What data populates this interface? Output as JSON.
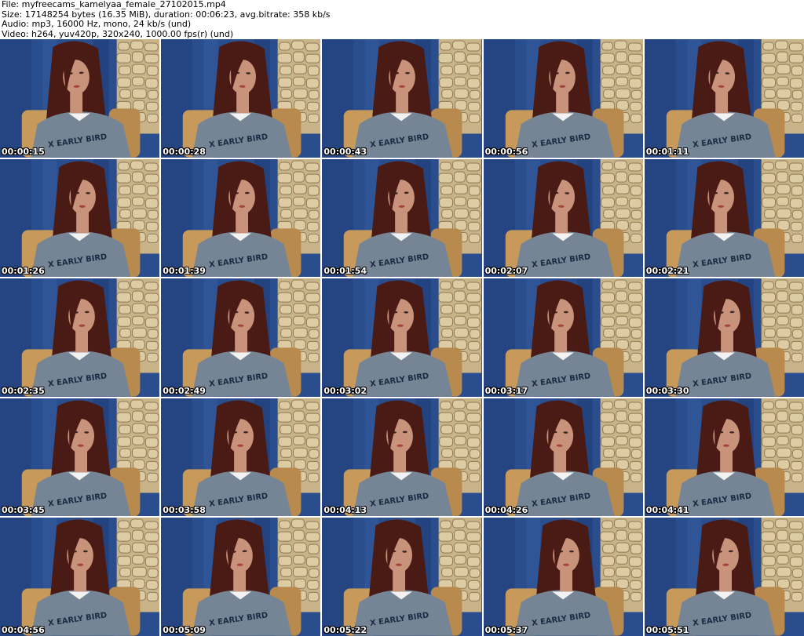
{
  "header": {
    "file_line": "File: myfreecams_kamelyaa_female_27102015.mp4",
    "size_line": "Size: 17148254 bytes (16.35 MiB), duration: 00:06:23, avg.bitrate: 358 kb/s",
    "audio_line": "Audio: mp3, 16000 Hz, mono, 24 kb/s (und)",
    "video_line": "Video: h264, yuv420p, 320x240, 1000.00 fps(r) (und)"
  },
  "thumbnails": [
    {
      "timestamp": "00:00:15",
      "shirt_text": "X EARLY BIRD"
    },
    {
      "timestamp": "00:00:28",
      "shirt_text": "X EARLY BIRD"
    },
    {
      "timestamp": "00:00:43",
      "shirt_text": "X EARLY BIRD"
    },
    {
      "timestamp": "00:00:56",
      "shirt_text": "X EARLY BIRD"
    },
    {
      "timestamp": "00:01:11",
      "shirt_text": "X EARLY BIRD"
    },
    {
      "timestamp": "00:01:26",
      "shirt_text": "X EARLY BIRD"
    },
    {
      "timestamp": "00:01:39",
      "shirt_text": "X EARLY BIRD"
    },
    {
      "timestamp": "00:01:54",
      "shirt_text": "X EARLY BIRD"
    },
    {
      "timestamp": "00:02:07",
      "shirt_text": "X EARLY BIRD"
    },
    {
      "timestamp": "00:02:21",
      "shirt_text": "X EARLY BIRD"
    },
    {
      "timestamp": "00:02:35",
      "shirt_text": "X EARLY BIRD"
    },
    {
      "timestamp": "00:02:49",
      "shirt_text": "X EARLY BIRD"
    },
    {
      "timestamp": "00:03:02",
      "shirt_text": "X EARLY BIRD"
    },
    {
      "timestamp": "00:03:17",
      "shirt_text": "X EARLY BIRD"
    },
    {
      "timestamp": "00:03:30",
      "shirt_text": "X EARLY BIRD"
    },
    {
      "timestamp": "00:03:45",
      "shirt_text": "X EARLY BIRD"
    },
    {
      "timestamp": "00:03:58",
      "shirt_text": "X EARLY BIRD"
    },
    {
      "timestamp": "00:04:13",
      "shirt_text": "X EARLY BIRD"
    },
    {
      "timestamp": "00:04:26",
      "shirt_text": "X EARLY BIRD"
    },
    {
      "timestamp": "00:04:41",
      "shirt_text": "X EARLY BIRD"
    },
    {
      "timestamp": "00:04:56",
      "shirt_text": "X EARLY BIRD"
    },
    {
      "timestamp": "00:05:09",
      "shirt_text": "X EARLY BIRD"
    },
    {
      "timestamp": "00:05:22",
      "shirt_text": "X EARLY BIRD"
    },
    {
      "timestamp": "00:05:37",
      "shirt_text": "X EARLY BIRD"
    },
    {
      "timestamp": "00:05:51",
      "shirt_text": "X EARLY BIRD"
    }
  ],
  "colors": {
    "background": "#ffffff",
    "curtain_blue": "#2a4d8e",
    "stone_wall": "#c9b48a",
    "sweater_gray": "#6f7f8f",
    "hair_dark_red": "#4a1a14",
    "skin": "#c9927a",
    "timestamp_text": "#ffffff"
  }
}
